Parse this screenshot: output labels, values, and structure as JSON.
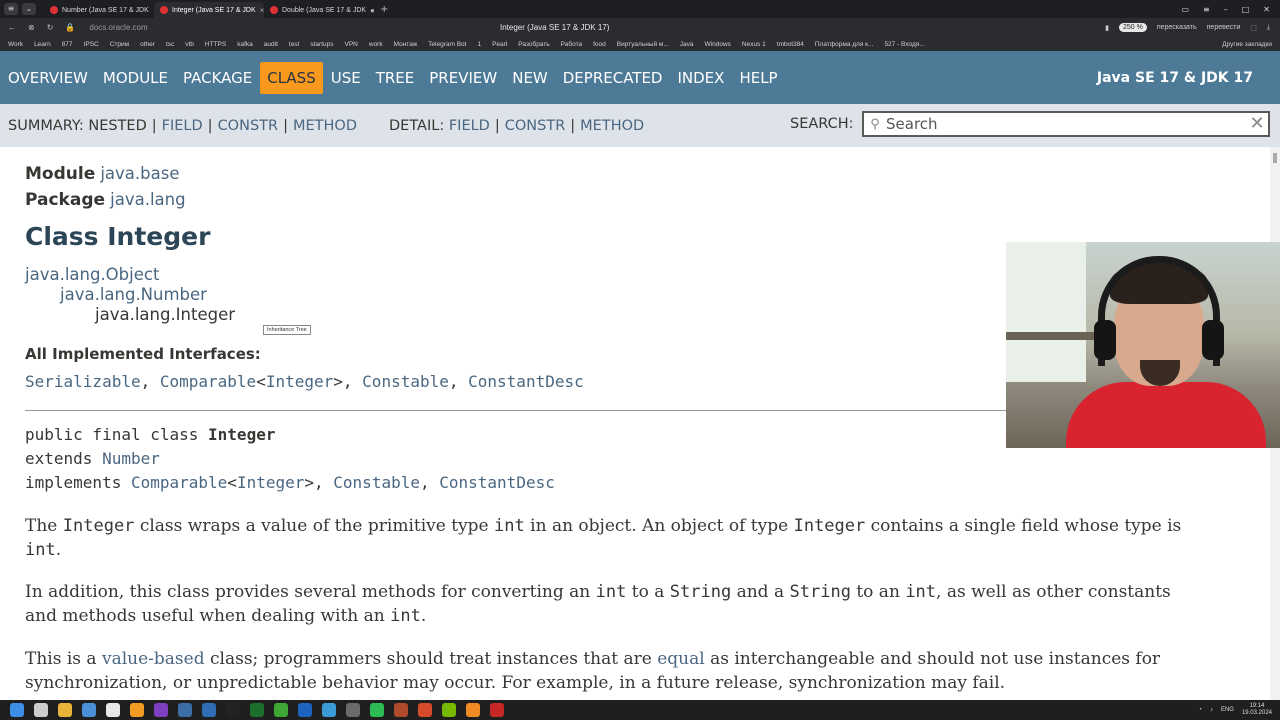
{
  "browser": {
    "tabs": [
      {
        "title": "Number (Java SE 17 & JDK",
        "active": false
      },
      {
        "title": "Integer (Java SE 17 & JDK",
        "active": true
      },
      {
        "title": "Double (Java SE 17 & JDK",
        "active": false
      }
    ],
    "url": "docs.oracle.com",
    "page_title": "Integer (Java SE 17 & JDK 17)",
    "zoom": "250 %",
    "ext1": "пересказать",
    "ext2": "перевести",
    "bookmarks": [
      "Work",
      "Learn",
      "877",
      "IPSC",
      "Стрим",
      "other",
      "tsc",
      "vtb",
      "HTTPS",
      "kafka",
      "audit",
      "test",
      "startups",
      "VPN",
      "work",
      "Монтаж",
      "Telegram Bot",
      "1",
      "Pearl",
      "Разобрать",
      "Работа",
      "food",
      "Виртуальный м...",
      "Java",
      "Windows",
      "Nexus 1",
      "tmbot384",
      "Платформа для к...",
      "527 - Входя..."
    ],
    "bookmarks_other": "Другие закладки"
  },
  "nav": {
    "items": [
      "OVERVIEW",
      "MODULE",
      "PACKAGE",
      "CLASS",
      "USE",
      "TREE",
      "PREVIEW",
      "NEW",
      "DEPRECATED",
      "INDEX",
      "HELP"
    ],
    "selected": "CLASS",
    "brand": "Java SE 17 & JDK 17"
  },
  "subnav": {
    "summary_label": "SUMMARY:",
    "summary_nested": "NESTED",
    "summary_field": "FIELD",
    "summary_constr": "CONSTR",
    "summary_method": "METHOD",
    "detail_label": "DETAIL:",
    "detail_field": "FIELD",
    "detail_constr": "CONSTR",
    "detail_method": "METHOD",
    "search_label": "SEARCH:",
    "search_placeholder": "Search"
  },
  "content": {
    "module_label": "Module",
    "module_value": "java.base",
    "package_label": "Package",
    "package_value": "java.lang",
    "title": "Class Integer",
    "inheritance": [
      "java.lang.Object",
      "java.lang.Number",
      "java.lang.Integer"
    ],
    "tooltip": "Inheritance Tree",
    "interfaces_label": "All Implemented Interfaces:",
    "interfaces": {
      "i1": "Serializable",
      "i2": "Comparable",
      "i2_param": "Integer",
      "i3": "Constable",
      "i4": "ConstantDesc"
    },
    "signature": {
      "decl_prefix": "public final class ",
      "decl_name": "Integer",
      "extends_kw": "extends ",
      "extends_name": "Number",
      "implements_kw": "implements ",
      "impl1": "Comparable",
      "impl1_param": "Integer",
      "impl2": "Constable",
      "impl3": "ConstantDesc"
    },
    "para1": {
      "t1": "The ",
      "c1": "Integer",
      "t2": " class wraps a value of the primitive type ",
      "c2": "int",
      "t3": " in an object. An object of type ",
      "c3": "Integer",
      "t4": " contains a single field whose type is",
      "c4": "int",
      "t5": "."
    },
    "para2": {
      "t1": "In addition, this class provides several methods for converting an ",
      "c1": "int",
      "t2": " to a ",
      "c2": "String",
      "t3": " and a ",
      "c3": "String",
      "t4": " to an ",
      "c4": "int",
      "t5": ", as well as other constants",
      "t6": "and methods useful when dealing with an ",
      "c5": "int",
      "t7": "."
    },
    "para3": {
      "t1": "This is a ",
      "l1": "value-based",
      "t2": " class; programmers should treat instances that are ",
      "l2": "equal",
      "t3": " as interchangeable and should not use instances for",
      "t4": "synchronization, or unpredictable behavior may occur. For example, in a future release, synchronization may fail."
    }
  },
  "taskbar": {
    "lang": "ENG",
    "time": "19:14",
    "date": "19.03.2024"
  },
  "colors": {
    "nav_bg": "#4d7a97",
    "nav_selected": "#f8981d",
    "subnav_bg": "#dee3e9",
    "link": "#4a6782"
  }
}
